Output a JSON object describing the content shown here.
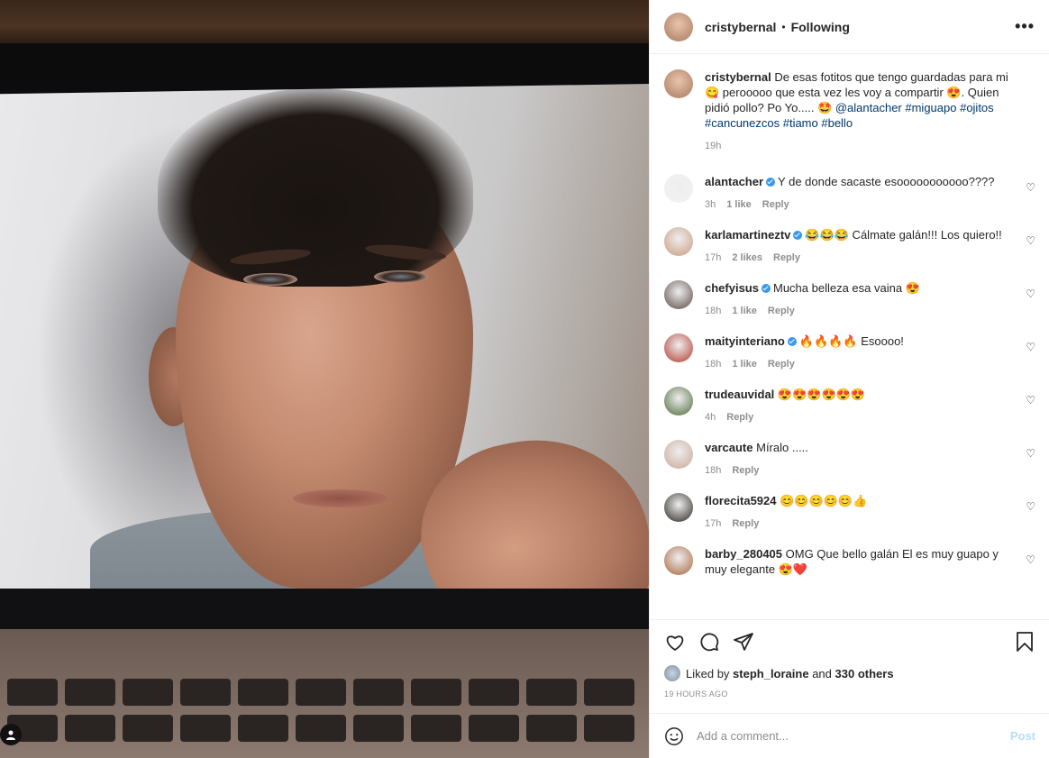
{
  "post": {
    "author": "cristybernal",
    "follow_status": "Following",
    "more_icon": "more-horizontal-icon",
    "caption": {
      "username": "cristybernal",
      "text": "De esas fotitos que tengo guardadas para mi 😋 perooooo que esta vez les voy a compartir 😍. Quien pidió pollo? Po Yo..... 🤩",
      "tags": "@alantacher #miguapo #ojitos #cancunezcos #tiamo #bello",
      "time": "19h"
    }
  },
  "comments": [
    {
      "username": "alantacher",
      "verified": true,
      "text": "Y de donde sacaste esooooooooooo????",
      "time": "3h",
      "likes": "1 like",
      "reply": "Reply",
      "avatar_color": "#f2f2f2"
    },
    {
      "username": "karlamartineztv",
      "verified": true,
      "text": "😂😂😂 Cálmate galán!!! Los quiero!!",
      "time": "17h",
      "likes": "2 likes",
      "reply": "Reply",
      "avatar_color": "#c89a7f"
    },
    {
      "username": "chefyisus",
      "verified": true,
      "text": "Mucha belleza esa vaina 😍",
      "time": "18h",
      "likes": "1 like",
      "reply": "Reply",
      "avatar_color": "#5b4a43"
    },
    {
      "username": "maityinteriano",
      "verified": true,
      "text": "🔥🔥🔥🔥 Esoooo!",
      "time": "18h",
      "likes": "1 like",
      "reply": "Reply",
      "avatar_color": "#b33a2e"
    },
    {
      "username": "trudeauvidal",
      "verified": false,
      "text": "😍😍😍😍😍😍",
      "time": "4h",
      "likes": "",
      "reply": "Reply",
      "avatar_color": "#4f6a3a"
    },
    {
      "username": "varcaute",
      "verified": false,
      "text": "Míralo .....",
      "time": "18h",
      "likes": "",
      "reply": "Reply",
      "avatar_color": "#c9a895"
    },
    {
      "username": "florecita5924",
      "verified": false,
      "text": "😊😊😊😊😊👍",
      "time": "17h",
      "likes": "",
      "reply": "Reply",
      "avatar_color": "#2b2620"
    },
    {
      "username": "barby_280405",
      "verified": false,
      "text": "OMG Que bello galán El es muy guapo y muy elegante 😍❤️",
      "time": "",
      "likes": "",
      "reply": "",
      "avatar_color": "#a9643b"
    }
  ],
  "actions": {
    "like_icon": "heart-icon",
    "comment_icon": "comment-icon",
    "share_icon": "share-icon",
    "save_icon": "bookmark-icon",
    "liked_by_prefix": "Liked by",
    "liked_by_user": "steph_loraine",
    "liked_by_and": "and",
    "liked_by_others": "330 others",
    "timestamp": "19 HOURS AGO"
  },
  "add_comment": {
    "placeholder": "Add a comment...",
    "post_label": "Post",
    "emoji_icon": "smile-icon"
  },
  "colors": {
    "verified": "#3897f0",
    "link": "#00376b",
    "post_disabled": "#b2dffc",
    "muted": "#8e8e8e"
  }
}
